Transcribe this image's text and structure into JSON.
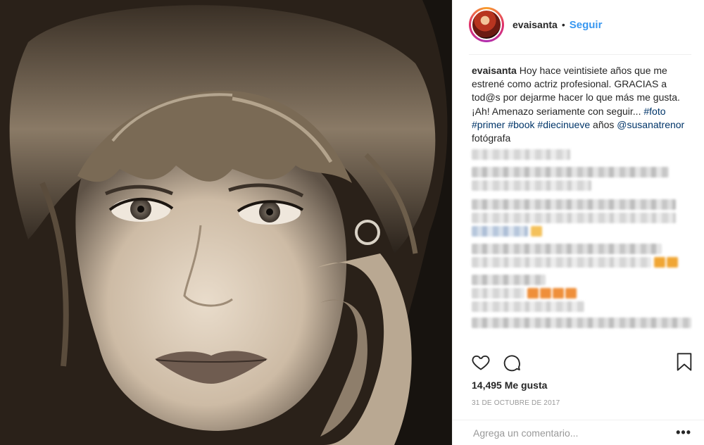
{
  "post": {
    "username": "evaisanta",
    "separator": "•",
    "follow_label": "Seguir",
    "caption": {
      "username": "evaisanta",
      "text": " Hoy hace veintisiete años que me estrené como actriz profesional. GRACIAS a tod@s por dejarme hacer lo que más me gusta. ¡Ah! Amenazo seriamente con seguir... ",
      "hashtags": [
        "#foto",
        "#primer",
        "#book",
        "#diecinueve"
      ],
      "after_tags": " años ",
      "mention": "@susanatrenor",
      "after_mention": " fotógrafa"
    },
    "likes_label": "14,495 Me gusta",
    "date": "31 DE OCTUBRE DE 2017",
    "comment_placeholder": "Agrega un comentario...",
    "more_label": "•••"
  },
  "icons": {
    "like": "heart-icon",
    "comment": "comment-icon",
    "save": "bookmark-icon",
    "more": "more-options-icon"
  },
  "colors": {
    "link": "#3897f0",
    "hashtag": "#003569",
    "text": "#262626",
    "muted": "#999999"
  }
}
